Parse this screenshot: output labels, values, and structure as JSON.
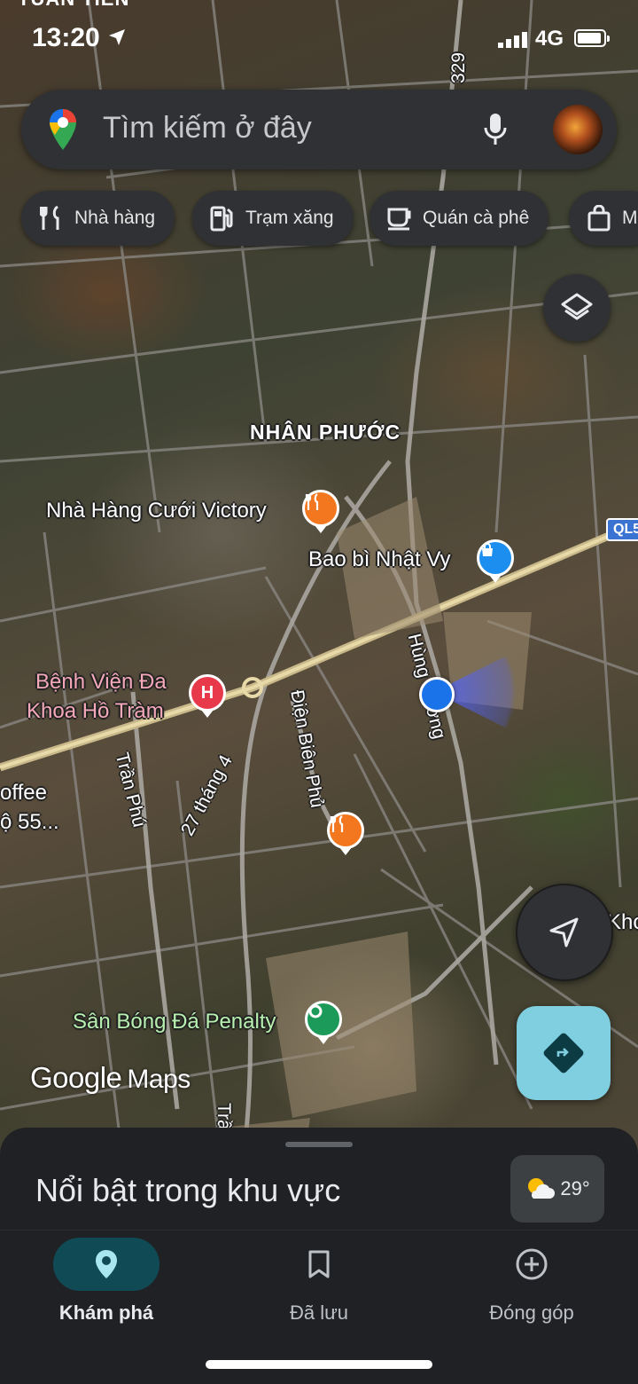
{
  "status_bar": {
    "carrier": "TUẤN TIẾN",
    "time": "13:20",
    "network": "4G"
  },
  "search": {
    "placeholder": "Tìm kiếm ở đây",
    "icons": [
      "google-maps-pin-icon",
      "mic-icon",
      "profile-avatar"
    ]
  },
  "chips": [
    {
      "label": "Nhà hàng",
      "icon": "fork-knife-icon"
    },
    {
      "label": "Trạm xăng",
      "icon": "gas-station-icon"
    },
    {
      "label": "Quán cà phê",
      "icon": "coffee-cup-icon"
    },
    {
      "label": "M",
      "icon": "shopping-bag-icon"
    }
  ],
  "map": {
    "area_label": "NHÂN PHƯỚC",
    "places": {
      "restaurant_victory": "Nhà Hàng Cưới Victory",
      "bao_bi": "Bao bì Nhật Vy",
      "hospital_line1": "Bệnh Viện Đa",
      "hospital_line2": "Khoa Hồ Tràm",
      "coffee_line1": "offee",
      "coffee_line2": "ộ 55...",
      "football": "Sân Bóng Đá Penalty",
      "edge_right": "Kho"
    },
    "streets": {
      "hung_vuong": "Hùng Vương",
      "dien_bien_phu": "Điện Biên Phủ",
      "thang_4": "27 tháng 4",
      "tran_phu": "Trần Phú",
      "tran_bottom": "Trầ",
      "road_329": "329"
    },
    "highway_badge": "QL5",
    "pin_hospital_letter": "H",
    "branding": {
      "google": "Google",
      "maps": "Maps"
    }
  },
  "bottom_sheet": {
    "title": "Nổi bật trong khu vực",
    "temperature": "29°",
    "weather_icon": "partly-sunny-icon"
  },
  "bottom_nav": [
    {
      "label": "Khám phá",
      "icon": "explore-pin-icon",
      "active": true
    },
    {
      "label": "Đã lưu",
      "icon": "bookmark-icon",
      "active": false
    },
    {
      "label": "Đóng góp",
      "icon": "add-circle-icon",
      "active": false
    }
  ],
  "colors": {
    "accent_nav": "#0f4a55",
    "directions_button": "#7fcfe0",
    "location_dot": "#1a73e8"
  }
}
